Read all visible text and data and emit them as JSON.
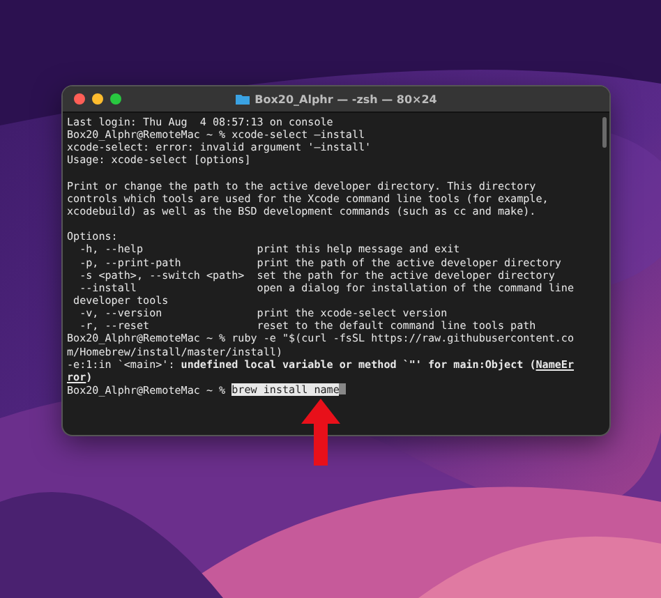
{
  "window": {
    "title": "Box20_Alphr — -zsh — 80×24"
  },
  "terminal": {
    "lines": [
      {
        "segments": [
          {
            "kind": "plain",
            "text": "Last login: Thu Aug  4 08:57:13 on console"
          }
        ]
      },
      {
        "segments": [
          {
            "kind": "plain",
            "text": "Box20_Alphr@RemoteMac ~ % xcode-select —install"
          }
        ]
      },
      {
        "segments": [
          {
            "kind": "plain",
            "text": "xcode-select: error: invalid argument '—install'"
          }
        ]
      },
      {
        "segments": [
          {
            "kind": "plain",
            "text": "Usage: xcode-select [options]"
          }
        ]
      },
      {
        "gap_before": true,
        "segments": [
          {
            "kind": "plain",
            "text": "Print or change the path to the active developer directory. This directory"
          }
        ]
      },
      {
        "segments": [
          {
            "kind": "plain",
            "text": "controls which tools are used for the Xcode command line tools (for example,"
          }
        ]
      },
      {
        "segments": [
          {
            "kind": "plain",
            "text": "xcodebuild) as well as the BSD development commands (such as cc and make)."
          }
        ]
      },
      {
        "gap_before": true,
        "segments": [
          {
            "kind": "plain",
            "text": "Options:"
          }
        ]
      },
      {
        "segments": [
          {
            "kind": "plain",
            "text": "  -h, --help                  print this help message and exit"
          }
        ]
      },
      {
        "segments": [
          {
            "kind": "plain",
            "text": "  -p, --print-path            print the path of the active developer directory"
          }
        ]
      },
      {
        "segments": [
          {
            "kind": "plain",
            "text": "  -s <path>, --switch <path>  set the path for the active developer directory"
          }
        ]
      },
      {
        "segments": [
          {
            "kind": "plain",
            "text": "  --install                   open a dialog for installation of the command line"
          }
        ]
      },
      {
        "segments": [
          {
            "kind": "plain",
            "text": " developer tools"
          }
        ]
      },
      {
        "segments": [
          {
            "kind": "plain",
            "text": "  -v, --version               print the xcode-select version"
          }
        ]
      },
      {
        "segments": [
          {
            "kind": "plain",
            "text": "  -r, --reset                 reset to the default command line tools path"
          }
        ]
      },
      {
        "segments": [
          {
            "kind": "plain",
            "text": "Box20_Alphr@RemoteMac ~ % ruby -e \"$(curl -fsSL https://raw.githubusercontent.co"
          }
        ]
      },
      {
        "segments": [
          {
            "kind": "plain",
            "text": "m/Homebrew/install/master/install)"
          }
        ]
      },
      {
        "segments": [
          {
            "kind": "plain",
            "text": "-e:1:in `<main>': "
          },
          {
            "kind": "bold",
            "text": "undefined local variable or method `\"' for main:Object ("
          },
          {
            "kind": "bold-underline",
            "text": "NameEr"
          }
        ]
      },
      {
        "segments": [
          {
            "kind": "bold-underline",
            "text": "ror"
          },
          {
            "kind": "bold",
            "text": ")"
          }
        ]
      }
    ],
    "prompt": {
      "text": "Box20_Alphr@RemoteMac ~ % ",
      "input": "brew install name",
      "selected": true
    }
  }
}
